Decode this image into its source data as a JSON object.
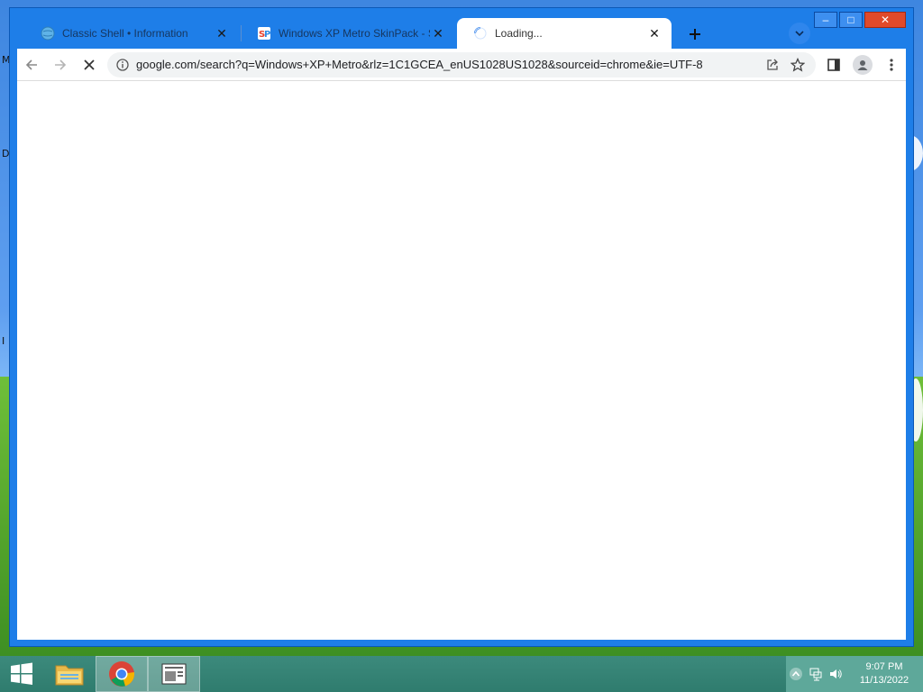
{
  "desktop": {
    "side_letters": [
      "M",
      "D",
      "I"
    ]
  },
  "window": {
    "controls": {
      "minimize": "–",
      "maximize": "□",
      "close": "✕"
    }
  },
  "tabs": [
    {
      "title": "Classic Shell • Information",
      "favicon": "globe-icon",
      "close": "✕"
    },
    {
      "title": "Windows XP Metro SkinPack - Sk",
      "favicon": "skinpack-icon",
      "close": "✕"
    },
    {
      "title": "Loading...",
      "favicon": "loading-spinner-icon",
      "close": "✕",
      "active": true
    }
  ],
  "toolbar": {
    "url": "google.com/search?q=Windows+XP+Metro&rlz=1C1GCEA_enUS1028US1028&sourceid=chrome&ie=UTF-8",
    "icons": [
      "back-icon",
      "forward-icon",
      "stop-icon",
      "info-icon",
      "share-icon",
      "bookmark-star-icon",
      "side-panel-icon",
      "profile-icon",
      "menu-icon"
    ]
  },
  "taskbar": {
    "apps": [
      "file-explorer-icon",
      "chrome-icon",
      "reader-icon"
    ],
    "clock": {
      "time": "9:07 PM",
      "date": "11/13/2022"
    }
  },
  "colors": {
    "window_frame": "#1e7ee8",
    "taskbar": "#2f7c6e",
    "close_button": "#e04a2b"
  }
}
